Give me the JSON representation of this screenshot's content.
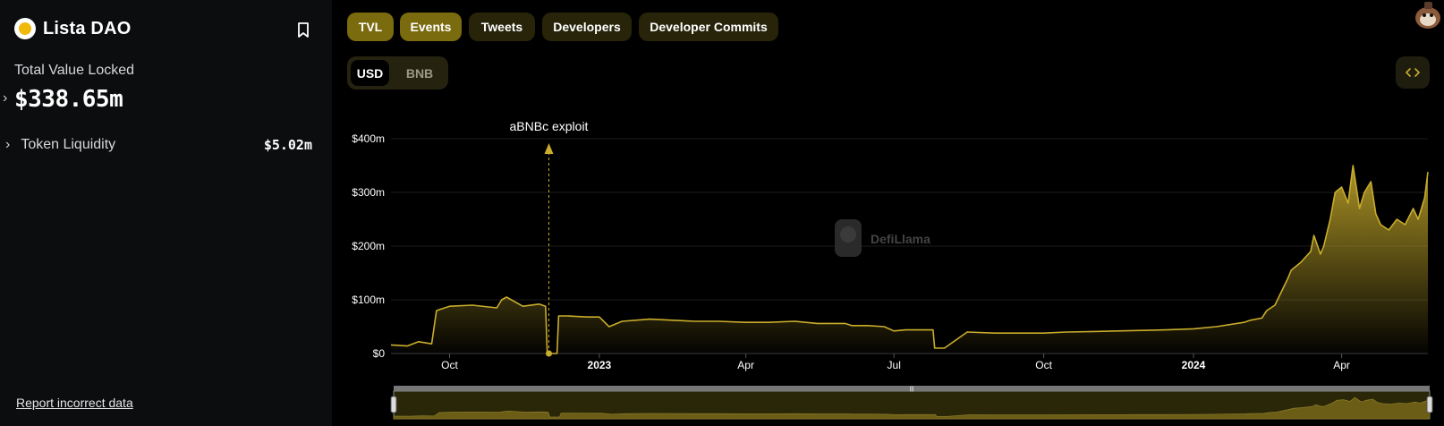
{
  "sidebar": {
    "brand_name": "Lista DAO",
    "tvl_label": "Total Value Locked",
    "tvl_value": "$338.65m",
    "token_liquidity_label": "Token Liquidity",
    "token_liquidity_value": "$5.02m",
    "report_link": "Report incorrect data"
  },
  "tabs": [
    {
      "label": "TVL",
      "active": true
    },
    {
      "label": "Events",
      "active": true
    },
    {
      "label": "Tweets",
      "active": false
    },
    {
      "label": "Developers",
      "active": false
    },
    {
      "label": "Developer Commits",
      "active": false
    }
  ],
  "unit_toggle": {
    "usd": "USD",
    "bnb": "BNB",
    "selected": "USD"
  },
  "watermark": "DefiLlama",
  "colors": {
    "accent": "#c9ad2c",
    "sidebar_bg": "#0b0d0e",
    "tab_active": "#7a6b0f",
    "tab_inactive": "#27240a"
  },
  "chart_data": {
    "type": "area",
    "series": [
      {
        "x": [
          "2022-08-26",
          "2022-09-05",
          "2022-09-12",
          "2022-09-20",
          "2022-09-23",
          "2022-10-01",
          "2022-10-15",
          "2022-10-30",
          "2022-11-02",
          "2022-11-05",
          "2022-11-15",
          "2022-11-25",
          "2022-11-29",
          "2022-11-30",
          "2022-12-06",
          "2022-12-07",
          "2022-12-07",
          "2022-12-12",
          "2022-12-25",
          "2023-01-01",
          "2023-01-07",
          "2023-01-15",
          "2023-02-01",
          "2023-02-15",
          "2023-03-01",
          "2023-03-15",
          "2023-04-01",
          "2023-04-15",
          "2023-05-01",
          "2023-05-15",
          "2023-06-01",
          "2023-06-05",
          "2023-06-15",
          "2023-06-25",
          "2023-07-01",
          "2023-07-08",
          "2023-07-25",
          "2023-07-26",
          "2023-08-01",
          "2023-08-15",
          "2023-09-01",
          "2023-10-01",
          "2023-10-15",
          "2023-11-01",
          "2023-11-15",
          "2023-12-01",
          "2023-12-15",
          "2024-01-01",
          "2024-01-15",
          "2024-02-01",
          "2024-02-05",
          "2024-02-12",
          "2024-02-15",
          "2024-02-20",
          "2024-02-28",
          "2024-03-01",
          "2024-03-07",
          "2024-03-10",
          "2024-03-13",
          "2024-03-15",
          "2024-03-19",
          "2024-03-21",
          "2024-03-25",
          "2024-03-28",
          "2024-04-01",
          "2024-04-05",
          "2024-04-08",
          "2024-04-12",
          "2024-04-15",
          "2024-04-19",
          "2024-04-22",
          "2024-04-25",
          "2024-04-30",
          "2024-05-05",
          "2024-05-10",
          "2024-05-15",
          "2024-05-18",
          "2024-05-22",
          "2024-05-24"
        ],
        "y": [
          16,
          14,
          22,
          18,
          80,
          88,
          90,
          85,
          100,
          105,
          88,
          92,
          88,
          0,
          0,
          70,
          70,
          70,
          68,
          68,
          50,
          60,
          64,
          62,
          60,
          60,
          58,
          58,
          60,
          56,
          56,
          52,
          52,
          50,
          42,
          44,
          44,
          10,
          10,
          40,
          38,
          38,
          40,
          41,
          42,
          43,
          44,
          46,
          50,
          58,
          62,
          66,
          80,
          90,
          140,
          155,
          170,
          180,
          190,
          220,
          185,
          200,
          250,
          300,
          310,
          280,
          350,
          270,
          300,
          320,
          260,
          240,
          230,
          250,
          240,
          270,
          250,
          290,
          338
        ]
      }
    ],
    "yticks": [
      "$0",
      "$100m",
      "$200m",
      "$300m",
      "$400m"
    ],
    "xticks": [
      "Oct",
      "2023",
      "Apr",
      "Jul",
      "Oct",
      "2024",
      "Apr"
    ],
    "ylim": [
      0,
      400
    ],
    "events": [
      {
        "date": "2022-12-01",
        "label": "aBNBc exploit"
      }
    ]
  }
}
